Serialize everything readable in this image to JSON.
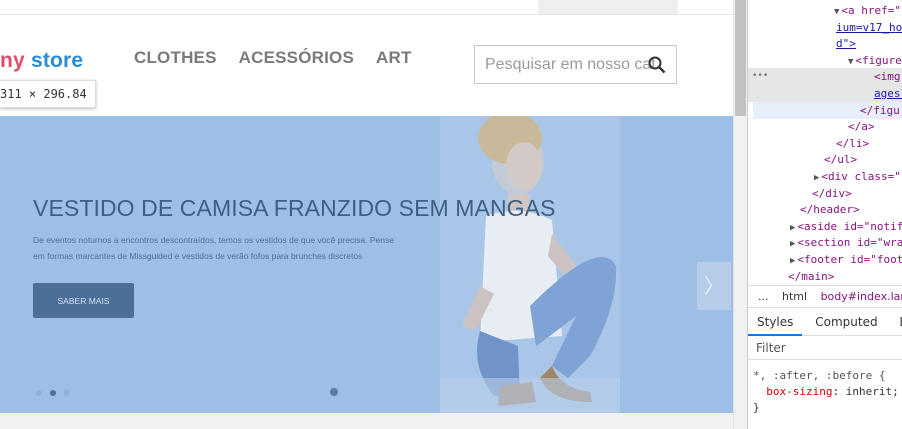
{
  "page": {
    "logo": {
      "part1": "ny ",
      "part2": "store"
    },
    "nav": [
      "CLOTHES",
      "ACESSÓRIOS",
      "ART"
    ],
    "search": {
      "placeholder": "Pesquisar em nosso catálogo",
      "icon": "search-icon"
    },
    "dimension_tooltip": "311 × 296.84",
    "hero": {
      "title": "VESTIDO DE CAMISA FRANZIDO SEM MANGAS",
      "description": "De eventos noturnos a encontros descontraídos, temos os vestidos de que você precisa. Pense em formas marcantes de Missguided e vestidos de verão fofos para brunches discretos",
      "button": "SABER MAIS",
      "next_arrow": "〉",
      "active_slide": 2,
      "slide_count": 3,
      "overlay_color": "#9dbfe6"
    }
  },
  "devtools": {
    "dom_lines": [
      {
        "indent": 86,
        "tri": "▼",
        "text": "<a href=\"",
        "kind": "tag"
      },
      {
        "indent": 88,
        "tri": "",
        "text": "ium=v17_ho",
        "kind": "link"
      },
      {
        "indent": 88,
        "tri": "",
        "text": "d\">",
        "kind": "link-tag"
      },
      {
        "indent": 100,
        "tri": "▼",
        "text": "<figure",
        "kind": "tag"
      },
      {
        "indent": 126,
        "tri": "",
        "text": "<img",
        "kind": "tag",
        "row": "hl"
      },
      {
        "indent": 126,
        "tri": "",
        "text": "agesl",
        "kind": "link",
        "row": "hl"
      },
      {
        "indent": 112,
        "tri": "",
        "text": "</figu",
        "kind": "tag",
        "row": "sel"
      },
      {
        "indent": 100,
        "tri": "",
        "text": "</a>",
        "kind": "tag"
      },
      {
        "indent": 88,
        "tri": "",
        "text": "</li>",
        "kind": "tag"
      },
      {
        "indent": 76,
        "tri": "",
        "text": "</ul>",
        "kind": "tag"
      },
      {
        "indent": 66,
        "tri": "▶",
        "text": "<div class=\"",
        "kind": "tag"
      },
      {
        "indent": 64,
        "tri": "",
        "text": "</div>",
        "kind": "tag"
      },
      {
        "indent": 52,
        "tri": "",
        "text": "</header>",
        "kind": "tag"
      },
      {
        "indent": 42,
        "tri": "▶",
        "text": "<aside id=\"notif",
        "kind": "tag"
      },
      {
        "indent": 42,
        "tri": "▶",
        "text": "<section id=\"wrap",
        "kind": "tag"
      },
      {
        "indent": 42,
        "tri": "▶",
        "text": "<footer id=\"foot",
        "kind": "tag"
      },
      {
        "indent": 40,
        "tri": "",
        "text": "</main>",
        "kind": "tag"
      }
    ],
    "ellipsis": "•••",
    "breadcrumbs": {
      "more": "...",
      "html": "html",
      "body": "body#index.lan"
    },
    "tabs": [
      "Styles",
      "Computed",
      "Lay"
    ],
    "active_tab": "Styles",
    "filter_placeholder": "Filter",
    "rule": {
      "selector": "*, :after, :before {",
      "property": "box-sizing",
      "value": ": inherit;",
      "close": "}"
    }
  }
}
